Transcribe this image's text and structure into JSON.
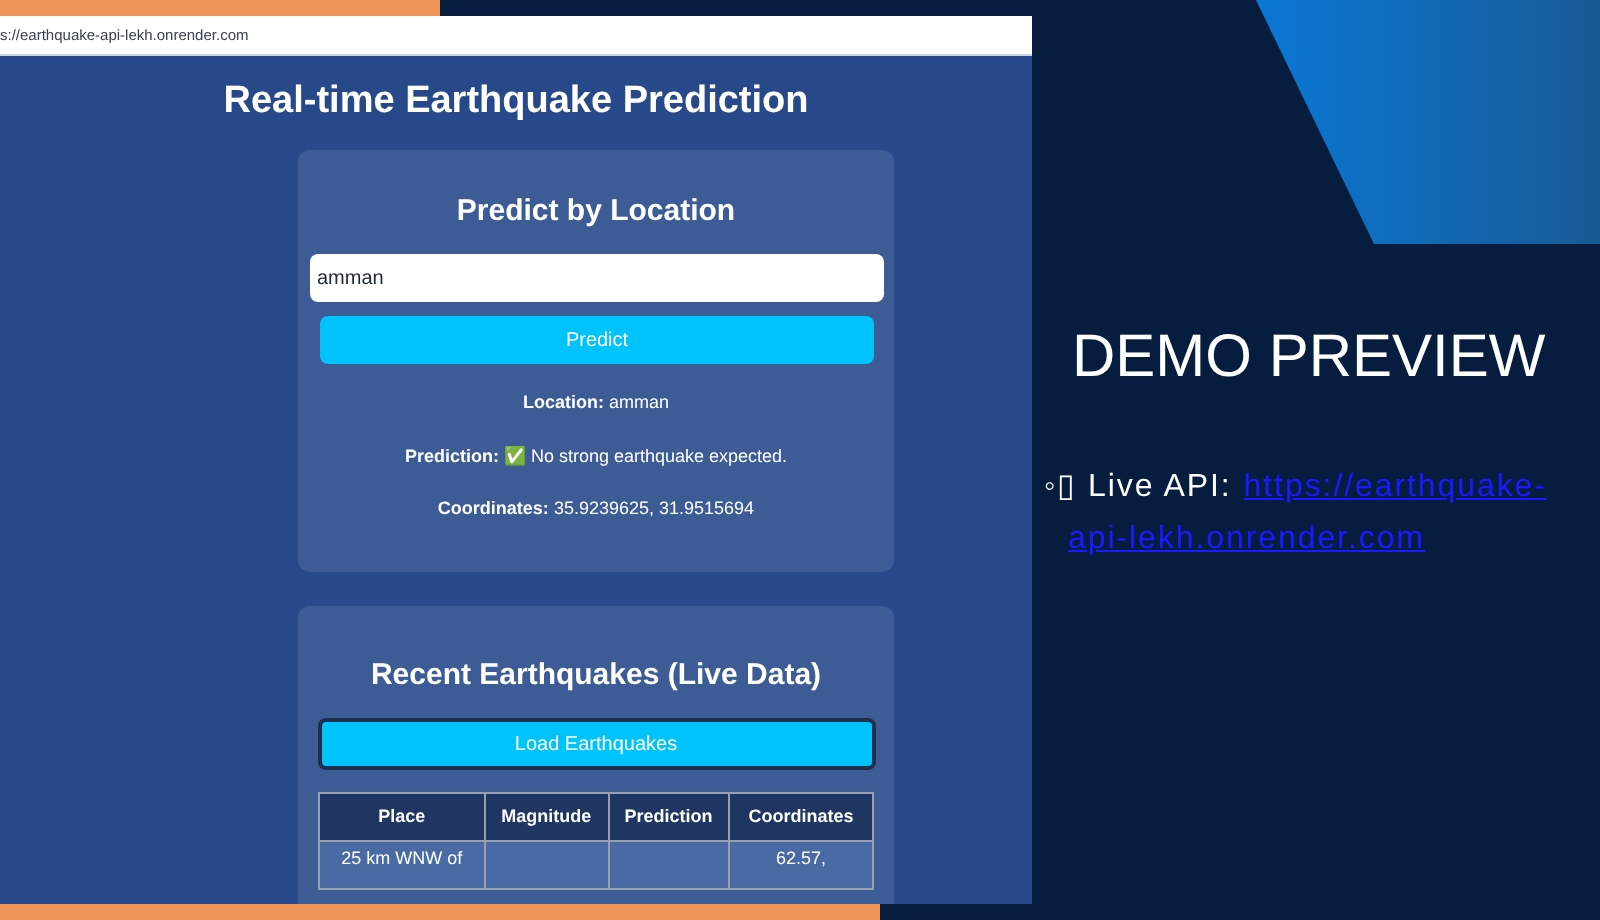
{
  "browser": {
    "url": "s://earthquake-api-lekh.onrender.com"
  },
  "page": {
    "title": "Real-time Earthquake Prediction"
  },
  "predict_card": {
    "title": "Predict by Location",
    "input_value": "amman",
    "button": "Predict",
    "results": [
      {
        "label": "Location:",
        "value": "amman"
      },
      {
        "label": "Prediction:",
        "value": "✅ No strong earthquake expected."
      },
      {
        "label": "Coordinates:",
        "value": "35.9239625, 31.9515694"
      }
    ]
  },
  "recent_card": {
    "title": "Recent Earthquakes (Live Data)",
    "button": "Load Earthquakes",
    "table": {
      "columns": [
        "Place",
        "Magnitude",
        "Prediction",
        "Coordinates"
      ],
      "rows": [
        [
          "25 km WNW of",
          "",
          "",
          "62.57,"
        ]
      ]
    }
  },
  "slide": {
    "heading": "DEMO PREVIEW",
    "bullet": "◦",
    "label": "▯ Live API:",
    "link_lines": [
      "https://earthquake-",
      "api-lekh.onrender.com"
    ]
  }
}
